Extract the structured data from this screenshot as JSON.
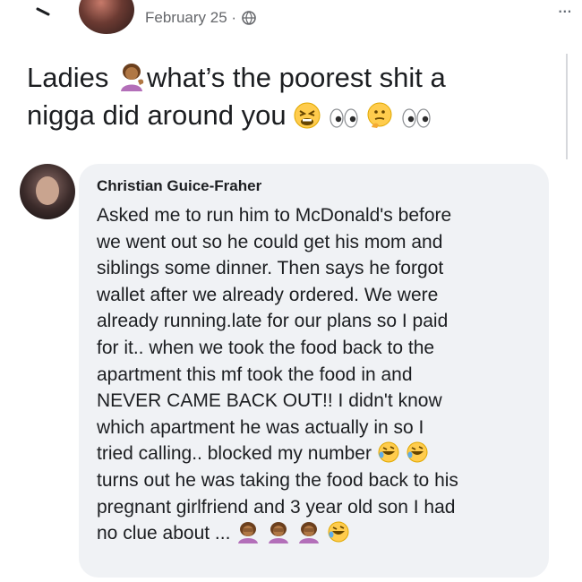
{
  "header": {
    "date": "February 25 ·",
    "icons": [
      "back-arrow-icon",
      "globe-icon",
      "more-options-icon"
    ],
    "more_label": "..."
  },
  "post": {
    "line1_a": "Ladies",
    "line1_b": "what’s the poorest shit a",
    "line2": "nigga did around you",
    "emojis": [
      "woman-tipping-hand-emoji",
      "tired-face-emoji",
      "eyes-emoji",
      "thinking-face-emoji",
      "eyes-emoji"
    ]
  },
  "comment": {
    "author": "Christian Guice-Fraher",
    "lines": [
      "Asked me to run him to McDonald's before",
      "we went out so he could get his mom and",
      "siblings some dinner. Then says he forgot",
      "wallet after we already ordered.  We were",
      "already running.late for our plans so I paid",
      "for it.. when we took the food back to the",
      "apartment this mf took the food in and",
      "NEVER CAME BACK OUT!! I didn't know",
      "which apartment he was actually in so I",
      "tried calling.. blocked my number",
      "turns out he was taking the food back to his",
      "pregnant girlfriend and 3 year old son I had",
      "no clue about ..."
    ],
    "emojis": [
      "rofl-emoji",
      "rofl-emoji",
      "woman-facepalming-emoji",
      "woman-facepalming-emoji",
      "woman-facepalming-emoji",
      "rofl-emoji"
    ]
  }
}
